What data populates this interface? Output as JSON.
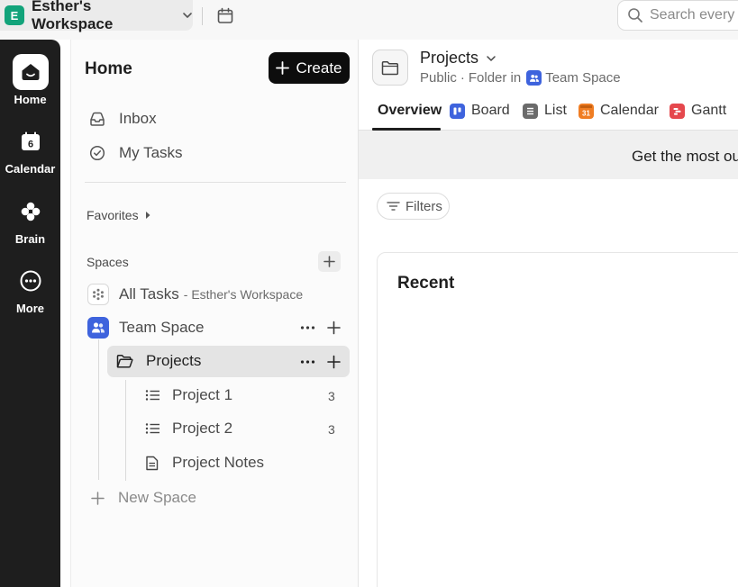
{
  "workspace": {
    "initial": "E",
    "name": "Esther's Workspace",
    "avatar_color": "#12a37a"
  },
  "search": {
    "placeholder": "Search every"
  },
  "rail": [
    {
      "label": "Home",
      "icon": "home-icon",
      "active": true
    },
    {
      "label": "Calendar",
      "icon": "calendar-day-icon",
      "day": "6"
    },
    {
      "label": "Brain",
      "icon": "brain-icon"
    },
    {
      "label": "More",
      "icon": "more-circle-icon"
    }
  ],
  "sidebar": {
    "title": "Home",
    "create_label": "Create",
    "inbox": "Inbox",
    "my_tasks": "My Tasks",
    "favorites": "Favorites",
    "spaces": "Spaces",
    "all_tasks": "All Tasks",
    "all_tasks_suffix": "- Esther's Workspace",
    "team_space": "Team Space",
    "projects": "Projects",
    "items": [
      {
        "label": "Project 1",
        "count": "3",
        "icon": "list-icon"
      },
      {
        "label": "Project 2",
        "count": "3",
        "icon": "list-icon"
      },
      {
        "label": "Project Notes",
        "icon": "doc-icon"
      }
    ],
    "new_space": "New Space"
  },
  "main": {
    "title": "Projects",
    "subtitle_public": "Public",
    "subtitle_sep": "·",
    "subtitle_folder_in": "Folder in",
    "subtitle_space": "Team Space",
    "tabs": [
      {
        "label": "Overview",
        "active": true
      },
      {
        "label": "Board",
        "icon": "board-icon",
        "color": "#3e63dd"
      },
      {
        "label": "List",
        "icon": "list-view-icon",
        "color": "#6b6b6b"
      },
      {
        "label": "Calendar",
        "icon": "calendar-icon",
        "color": "#f07d23",
        "day": "31"
      },
      {
        "label": "Gantt",
        "icon": "gantt-icon",
        "color": "#e5484d"
      }
    ],
    "banner": "Get the most ou",
    "filters": "Filters",
    "recent_title": "Recent"
  },
  "colors": {
    "rail_bg": "#1e1e1e",
    "team_space": "#3e63dd",
    "accent_dark": "#0d0d0d"
  }
}
